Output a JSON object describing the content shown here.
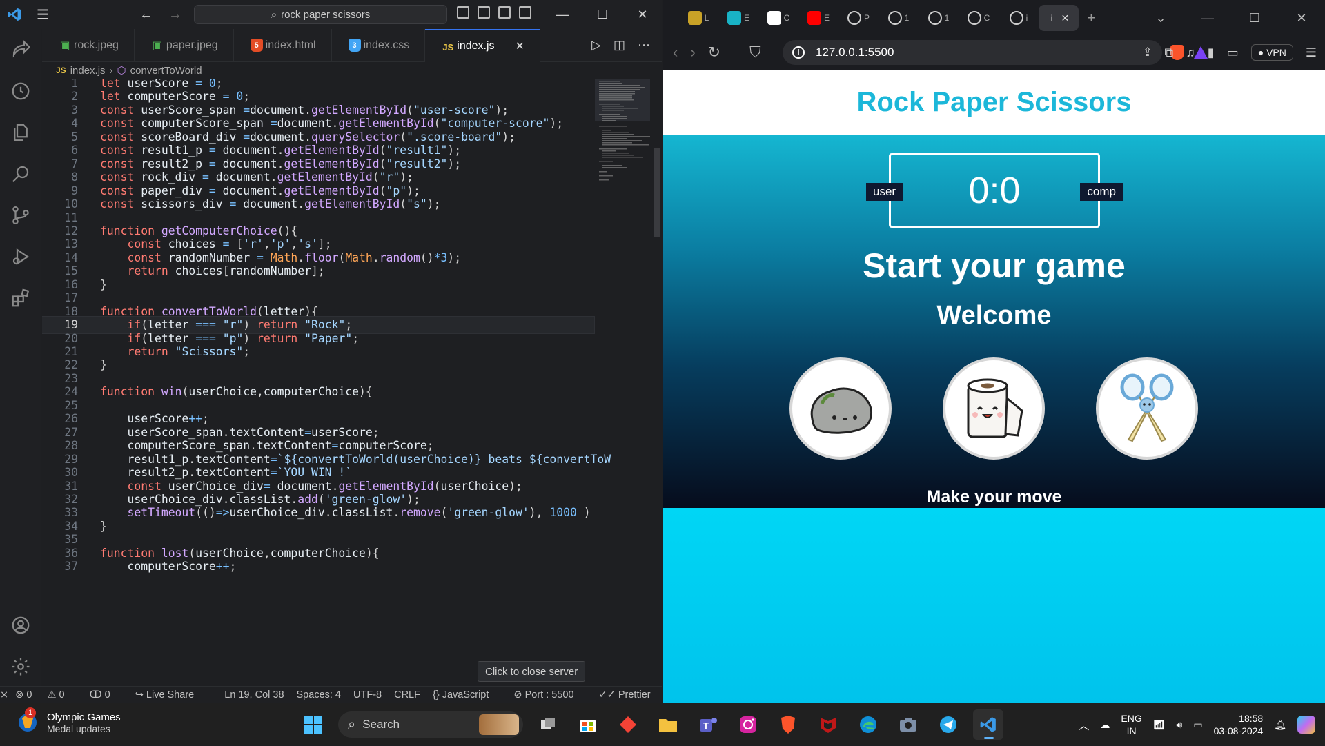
{
  "vscode": {
    "command_center": "rock paper scissors",
    "tabs": [
      {
        "label": "rock.jpeg",
        "icon": "image-icon",
        "color": "#4caf50"
      },
      {
        "label": "paper.jpeg",
        "icon": "image-icon",
        "color": "#4caf50"
      },
      {
        "label": "index.html",
        "icon": "html-icon",
        "color": "#e44d26"
      },
      {
        "label": "index.css",
        "icon": "css-icon",
        "color": "#42a5f5"
      },
      {
        "label": "index.js",
        "icon": "js-icon",
        "color": "#e8c547",
        "active": true
      }
    ],
    "breadcrumb": {
      "file": "index.js",
      "symbol": "convertToWorld"
    },
    "current_line": 19,
    "code_lines": [
      {
        "n": "1",
        "text": "let userScore = 0;"
      },
      {
        "n": "2",
        "text": "let computerScore = 0;"
      },
      {
        "n": "3",
        "text": "const userScore_span =document.getElementById(\"user-score\");"
      },
      {
        "n": "4",
        "text": "const computerScore_span =document.getElementById(\"computer-score\");"
      },
      {
        "n": "5",
        "text": "const scoreBoard_div =document.querySelector(\".score-board\");"
      },
      {
        "n": "6",
        "text": "const result1_p = document.getElementById(\"result1\");"
      },
      {
        "n": "7",
        "text": "const result2_p = document.getElementById(\"result2\");"
      },
      {
        "n": "8",
        "text": "const rock_div = document.getElementById(\"r\");"
      },
      {
        "n": "9",
        "text": "const paper_div = document.getElementById(\"p\");"
      },
      {
        "n": "10",
        "text": "const scissors_div = document.getElementById(\"s\");"
      },
      {
        "n": "11",
        "text": ""
      },
      {
        "n": "12",
        "text": "function getComputerChoice(){"
      },
      {
        "n": "13",
        "text": "    const choices = ['r','p','s'];"
      },
      {
        "n": "14",
        "text": "    const randomNumber = Math.floor(Math.random()*3);"
      },
      {
        "n": "15",
        "text": "    return choices[randomNumber];"
      },
      {
        "n": "16",
        "text": "}"
      },
      {
        "n": "17",
        "text": ""
      },
      {
        "n": "18",
        "text": "function convertToWorld(letter){"
      },
      {
        "n": "19",
        "text": "    if(letter === \"r\") return \"Rock\";"
      },
      {
        "n": "20",
        "text": "    if(letter === \"p\") return \"Paper\";"
      },
      {
        "n": "21",
        "text": "    return \"Scissors\";"
      },
      {
        "n": "22",
        "text": "}"
      },
      {
        "n": "23",
        "text": ""
      },
      {
        "n": "24",
        "text": "function win(userChoice,computerChoice){"
      },
      {
        "n": "25",
        "text": ""
      },
      {
        "n": "26",
        "text": "    userScore++;"
      },
      {
        "n": "27",
        "text": "    userScore_span.textContent=userScore;"
      },
      {
        "n": "28",
        "text": "    computerScore_span.textContent=computerScore;"
      },
      {
        "n": "29",
        "text": "    result1_p.textContent=`${convertToWorld(userChoice)} beats ${convertToW"
      },
      {
        "n": "30",
        "text": "    result2_p.textContent=`YOU WIN !`"
      },
      {
        "n": "31",
        "text": "    const userChoice_div= document.getElementById(userChoice);"
      },
      {
        "n": "32",
        "text": "    userChoice_div.classList.add('green-glow');"
      },
      {
        "n": "33",
        "text": "    setTimeout(()=>userChoice_div.classList.remove('green-glow'), 1000 )"
      },
      {
        "n": "34",
        "text": "}"
      },
      {
        "n": "35",
        "text": ""
      },
      {
        "n": "36",
        "text": "function lost(userChoice,computerChoice){"
      },
      {
        "n": "37",
        "text": "    computerScore++;"
      }
    ],
    "tooltip": "Click to close server",
    "status": {
      "errors": "0",
      "warnings": "0",
      "ports": "0",
      "live_share": "Live Share",
      "cursor": "Ln 19, Col 38",
      "spaces": "Spaces: 4",
      "encoding": "UTF-8",
      "eol": "CRLF",
      "language": "JavaScript",
      "port": "Port : 5500",
      "prettier": "Prettier"
    }
  },
  "browser": {
    "url": "127.0.0.1:5500",
    "vpn": "VPN",
    "tabs": [
      {
        "label": "L",
        "color": "#c9a227"
      },
      {
        "label": "E",
        "color": "#19b3c6"
      },
      {
        "label": "C",
        "color": "#ffffff"
      },
      {
        "label": "E",
        "color": "#ff0000"
      },
      {
        "label": "P",
        "color": "#888888"
      },
      {
        "label": "1",
        "color": "#888888"
      },
      {
        "label": "1",
        "color": "#888888"
      },
      {
        "label": "C",
        "color": "#888888"
      },
      {
        "label": "i",
        "color": "#888888"
      },
      {
        "label": "i",
        "color": "#888888",
        "active": true
      }
    ],
    "page": {
      "title": "Rock Paper Scissors",
      "user_label": "user",
      "comp_label": "comp",
      "score": "0:0",
      "result1": "Start your game",
      "result2": "Welcome",
      "move_prompt": "Make your move"
    }
  },
  "taskbar": {
    "widget_title": "Olympic Games",
    "widget_subtitle": "Medal updates",
    "widget_badge": "1",
    "search_placeholder": "Search",
    "lang_1": "ENG",
    "lang_2": "IN",
    "time": "18:58",
    "date": "03-08-2024"
  }
}
